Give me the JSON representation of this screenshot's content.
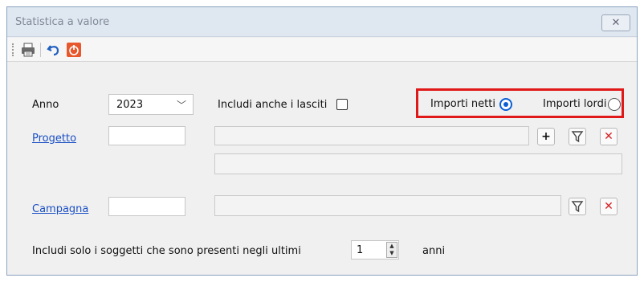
{
  "window": {
    "title": "Statistica a valore",
    "close_icon": "close-icon"
  },
  "toolbar": {
    "print_icon": "printer-icon",
    "undo_icon": "undo-icon",
    "exit_icon": "power-icon"
  },
  "form": {
    "anno_label": "Anno",
    "anno_value": "2023",
    "lasciti_label": "Includi anche i lasciti",
    "lasciti_checked": false,
    "importi_netti_label": "Importi netti",
    "importi_netti_selected": true,
    "importi_lordi_label": "Importi lordi",
    "importi_lordi_selected": false,
    "progetto_label": "Progetto",
    "progetto_code": "",
    "progetto_description": "",
    "progetto_extra": "",
    "campagna_label": "Campagna",
    "campagna_code": "",
    "campagna_description": "",
    "soggetti_label": "Includi solo i soggetti che sono presenti negli ultimi",
    "anni_value": "1",
    "anni_label": "anni"
  },
  "colors": {
    "highlight": "#e01818",
    "link": "#1a4fc4",
    "radio_selected": "#0a5fd6",
    "clear_red": "#d42020"
  }
}
